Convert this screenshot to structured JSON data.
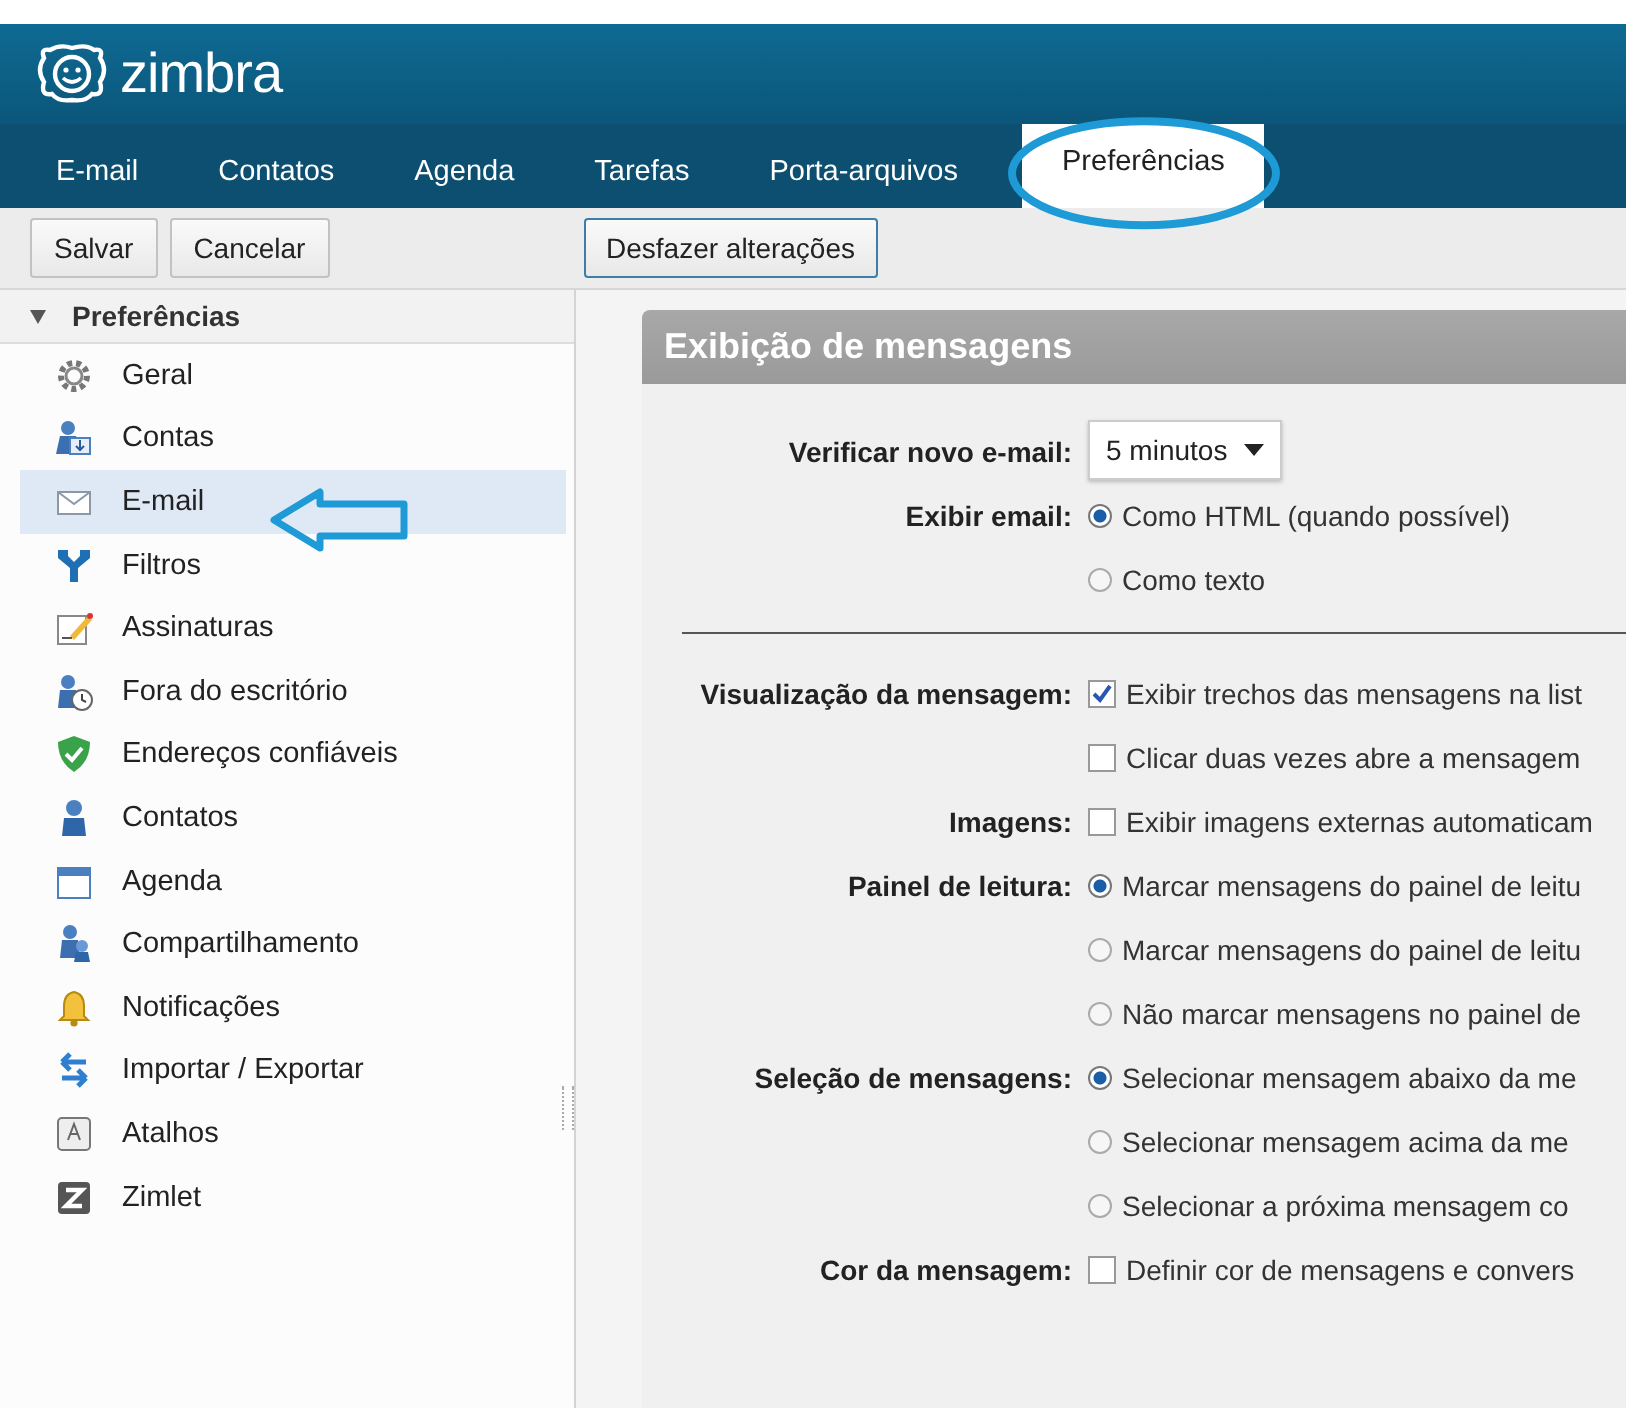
{
  "logo": {
    "text": "zimbra"
  },
  "tabs": [
    {
      "label": "E-mail",
      "selected": false
    },
    {
      "label": "Contatos",
      "selected": false
    },
    {
      "label": "Agenda",
      "selected": false
    },
    {
      "label": "Tarefas",
      "selected": false
    },
    {
      "label": "Porta-arquivos",
      "selected": false
    },
    {
      "label": "Preferências",
      "selected": true
    }
  ],
  "toolbar": {
    "buttons": [
      "Salvar",
      "Cancelar"
    ],
    "undo_button": "Desfazer alterações"
  },
  "sidebar": {
    "header": "Preferências",
    "expanded": true,
    "items": [
      {
        "label": "Geral",
        "kind": "gear",
        "selected": false
      },
      {
        "label": "Contas",
        "kind": "accounts",
        "selected": false
      },
      {
        "label": "E-mail",
        "kind": "envelope",
        "selected": true
      },
      {
        "label": "Filtros",
        "kind": "filter",
        "selected": false
      },
      {
        "label": "Assinaturas",
        "kind": "signature",
        "selected": false
      },
      {
        "label": "Fora do escritório",
        "kind": "clock",
        "selected": false
      },
      {
        "label": "Endereços confiáveis",
        "kind": "shield",
        "selected": false
      },
      {
        "label": "Contatos",
        "kind": "person",
        "selected": false
      },
      {
        "label": "Agenda",
        "kind": "calendar",
        "selected": false
      },
      {
        "label": "Compartilhamento",
        "kind": "share",
        "selected": false
      },
      {
        "label": "Notificações",
        "kind": "bell",
        "selected": false
      },
      {
        "label": "Importar / Exportar",
        "kind": "arrows",
        "selected": false
      },
      {
        "label": "Atalhos",
        "kind": "key",
        "selected": false
      },
      {
        "label": "Zimlet",
        "kind": "zimlet",
        "selected": false
      }
    ]
  },
  "section": {
    "title": "Exibição de mensagens",
    "groups": [
      {
        "kind": "dropdown",
        "label": "Verificar novo e-mail:",
        "value": "5 minutos"
      },
      {
        "kind": "radio",
        "label": "Exibir email:",
        "options": [
          {
            "text": "Como HTML (quando possível)",
            "selected": true
          },
          {
            "text": "Como texto",
            "selected": false
          }
        ]
      },
      {
        "kind": "divider"
      },
      {
        "kind": "checkbox",
        "label": "Visualização da mensagem:",
        "options": [
          {
            "text": "Exibir trechos das mensagens na list",
            "checked": true
          },
          {
            "text": "Clicar duas vezes abre a mensagem",
            "checked": false
          }
        ]
      },
      {
        "kind": "checkbox",
        "label": "Imagens:",
        "options": [
          {
            "text": "Exibir imagens externas automaticam",
            "checked": false
          }
        ]
      },
      {
        "kind": "radio",
        "label": "Painel de leitura:",
        "options": [
          {
            "text": "Marcar mensagens do painel de leitu",
            "selected": true
          },
          {
            "text": "Marcar mensagens do painel de leitu",
            "selected": false
          },
          {
            "text": "Não marcar mensagens no painel de",
            "selected": false
          }
        ]
      },
      {
        "kind": "radio",
        "label": "Seleção de mensagens:",
        "options": [
          {
            "text": "Selecionar mensagem abaixo da me",
            "selected": true
          },
          {
            "text": "Selecionar mensagem acima da me",
            "selected": false
          },
          {
            "text": "Selecionar a próxima mensagem co",
            "selected": false
          }
        ]
      },
      {
        "kind": "checkbox",
        "label": "Cor da mensagem:",
        "options": [
          {
            "text": "Definir cor de mensagens e convers",
            "checked": false
          }
        ]
      }
    ]
  }
}
